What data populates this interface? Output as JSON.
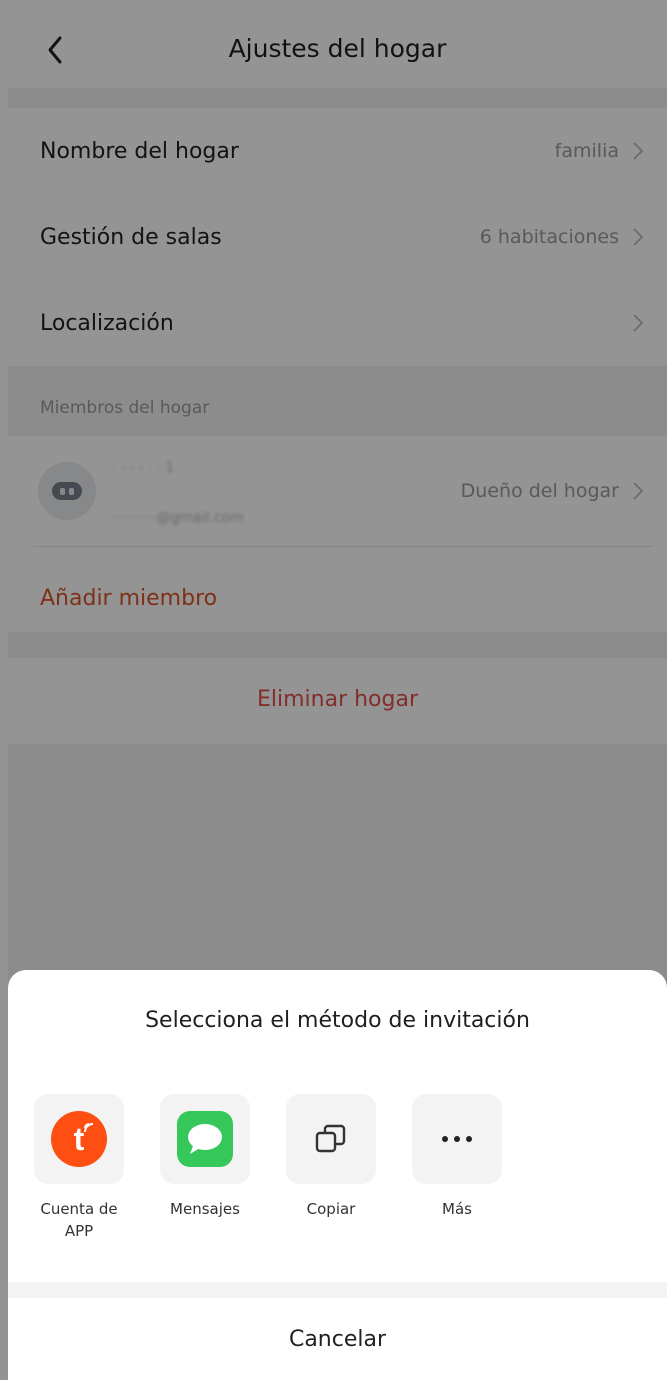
{
  "header": {
    "title": "Ajustes del hogar"
  },
  "settings": [
    {
      "label": "Nombre del hogar",
      "value": "familia"
    },
    {
      "label": "Gestión de salas",
      "value": "6 habitaciones"
    },
    {
      "label": "Localización",
      "value": ""
    }
  ],
  "members": {
    "section_label": "Miembros del hogar",
    "items": [
      {
        "name": "·  ·  ·  ·  ·  · 1",
        "email": "··········@gmail.com",
        "role": "Dueño del hogar"
      }
    ],
    "add_label": "Añadir miembro"
  },
  "delete_label": "Eliminar hogar",
  "sheet": {
    "title": "Selecciona el método de invitación",
    "options": [
      {
        "label": "Cuenta de APP",
        "icon": "tuya-app-icon"
      },
      {
        "label": "Mensajes",
        "icon": "messages-icon"
      },
      {
        "label": "Copiar",
        "icon": "copy-icon"
      },
      {
        "label": "Más",
        "icon": "more-dots-icon"
      }
    ],
    "cancel_label": "Cancelar"
  },
  "colors": {
    "accent": "#d9542a",
    "danger": "#e0504a",
    "tuya": "#ff4e12",
    "messages": "#35c759"
  }
}
